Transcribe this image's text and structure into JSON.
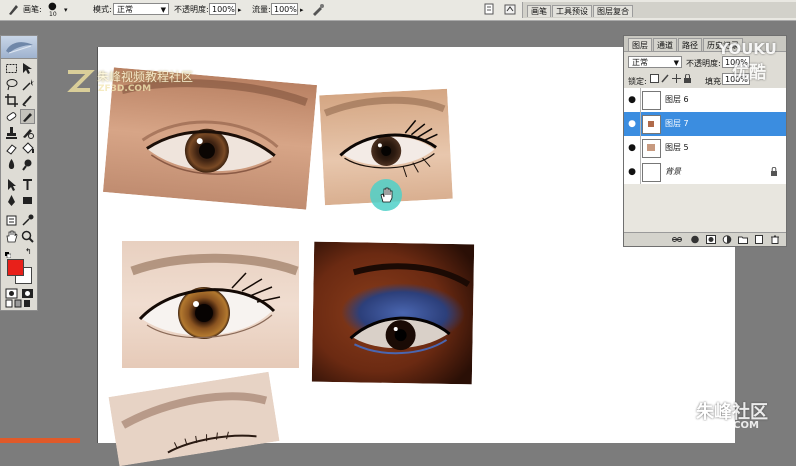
{
  "options_bar": {
    "brush_label": "画笔:",
    "brush_size": "10",
    "mode_label": "模式:",
    "mode_value": "正常",
    "opacity_label": "不透明度:",
    "opacity_value": "100%",
    "flow_label": "流量:",
    "flow_value": "100%"
  },
  "palette_well": {
    "tabs": [
      "画笔",
      "工具预设",
      "图层复合"
    ]
  },
  "colors": {
    "foreground": "#e8201a",
    "background": "#ffffff",
    "selected_layer": "#3b8de0",
    "cursor_highlight": "#4fd0c8"
  },
  "layers_panel": {
    "tabs": [
      "图层",
      "通道",
      "路径",
      "历史记录"
    ],
    "blend_mode": "正常",
    "opacity_label": "不透明度:",
    "opacity_value": "100%",
    "lock_label": "锁定:",
    "fill_label": "填充:",
    "fill_value": "100%",
    "layers": [
      {
        "name": "图层 6",
        "visible": true,
        "selected": false,
        "thumb": "transparent"
      },
      {
        "name": "图层 7",
        "visible": true,
        "selected": true,
        "thumb": "transparent-with-content"
      },
      {
        "name": "图层 5",
        "visible": true,
        "selected": false,
        "thumb": "transparent-with-content"
      },
      {
        "name": "背景",
        "visible": true,
        "selected": false,
        "thumb": "white",
        "locked": true
      }
    ]
  },
  "watermarks": {
    "site_cn": "朱峰视频教程社区",
    "site_url": "ZF3D.COM",
    "youku": "YOUKU",
    "youku_cn": "优酷",
    "corner_cn": "朱峰社区",
    "corner_url": "ZF3D.COM"
  }
}
